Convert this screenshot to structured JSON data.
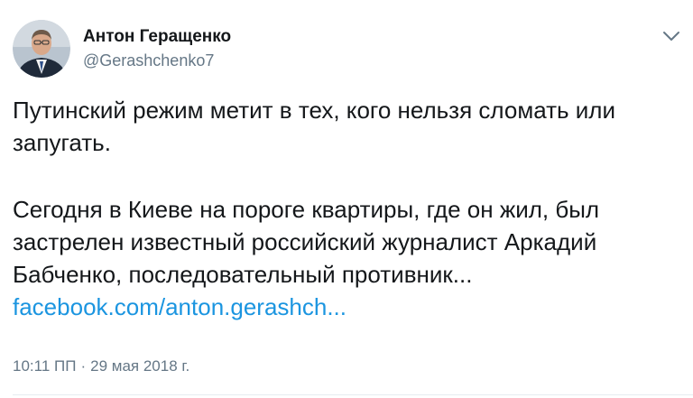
{
  "author": {
    "display_name": "Антон Геращенко",
    "handle": "@Gerashchenko7"
  },
  "tweet": {
    "paragraph_1": [
      "Путинский режим метит в тех, кого нельзя сломать или",
      "запугать."
    ],
    "paragraph_2": [
      "Сегодня в Киеве на пороге квартиры, где он жил,  был",
      "застрелен известный российский журналист Аркадий",
      "Бабченко, последовательный противник..."
    ],
    "link_text": "facebook.com/anton.gerashch...",
    "time": "10:11 ПП",
    "separator": "·",
    "date": "29 мая 2018 г."
  },
  "icons": {
    "menu": "chevron-down-icon",
    "avatar": "avatar-photo"
  },
  "colors": {
    "text_primary": "#14171a",
    "text_secondary": "#657786",
    "link": "#1b95e0",
    "divider": "#e6ecf0"
  }
}
